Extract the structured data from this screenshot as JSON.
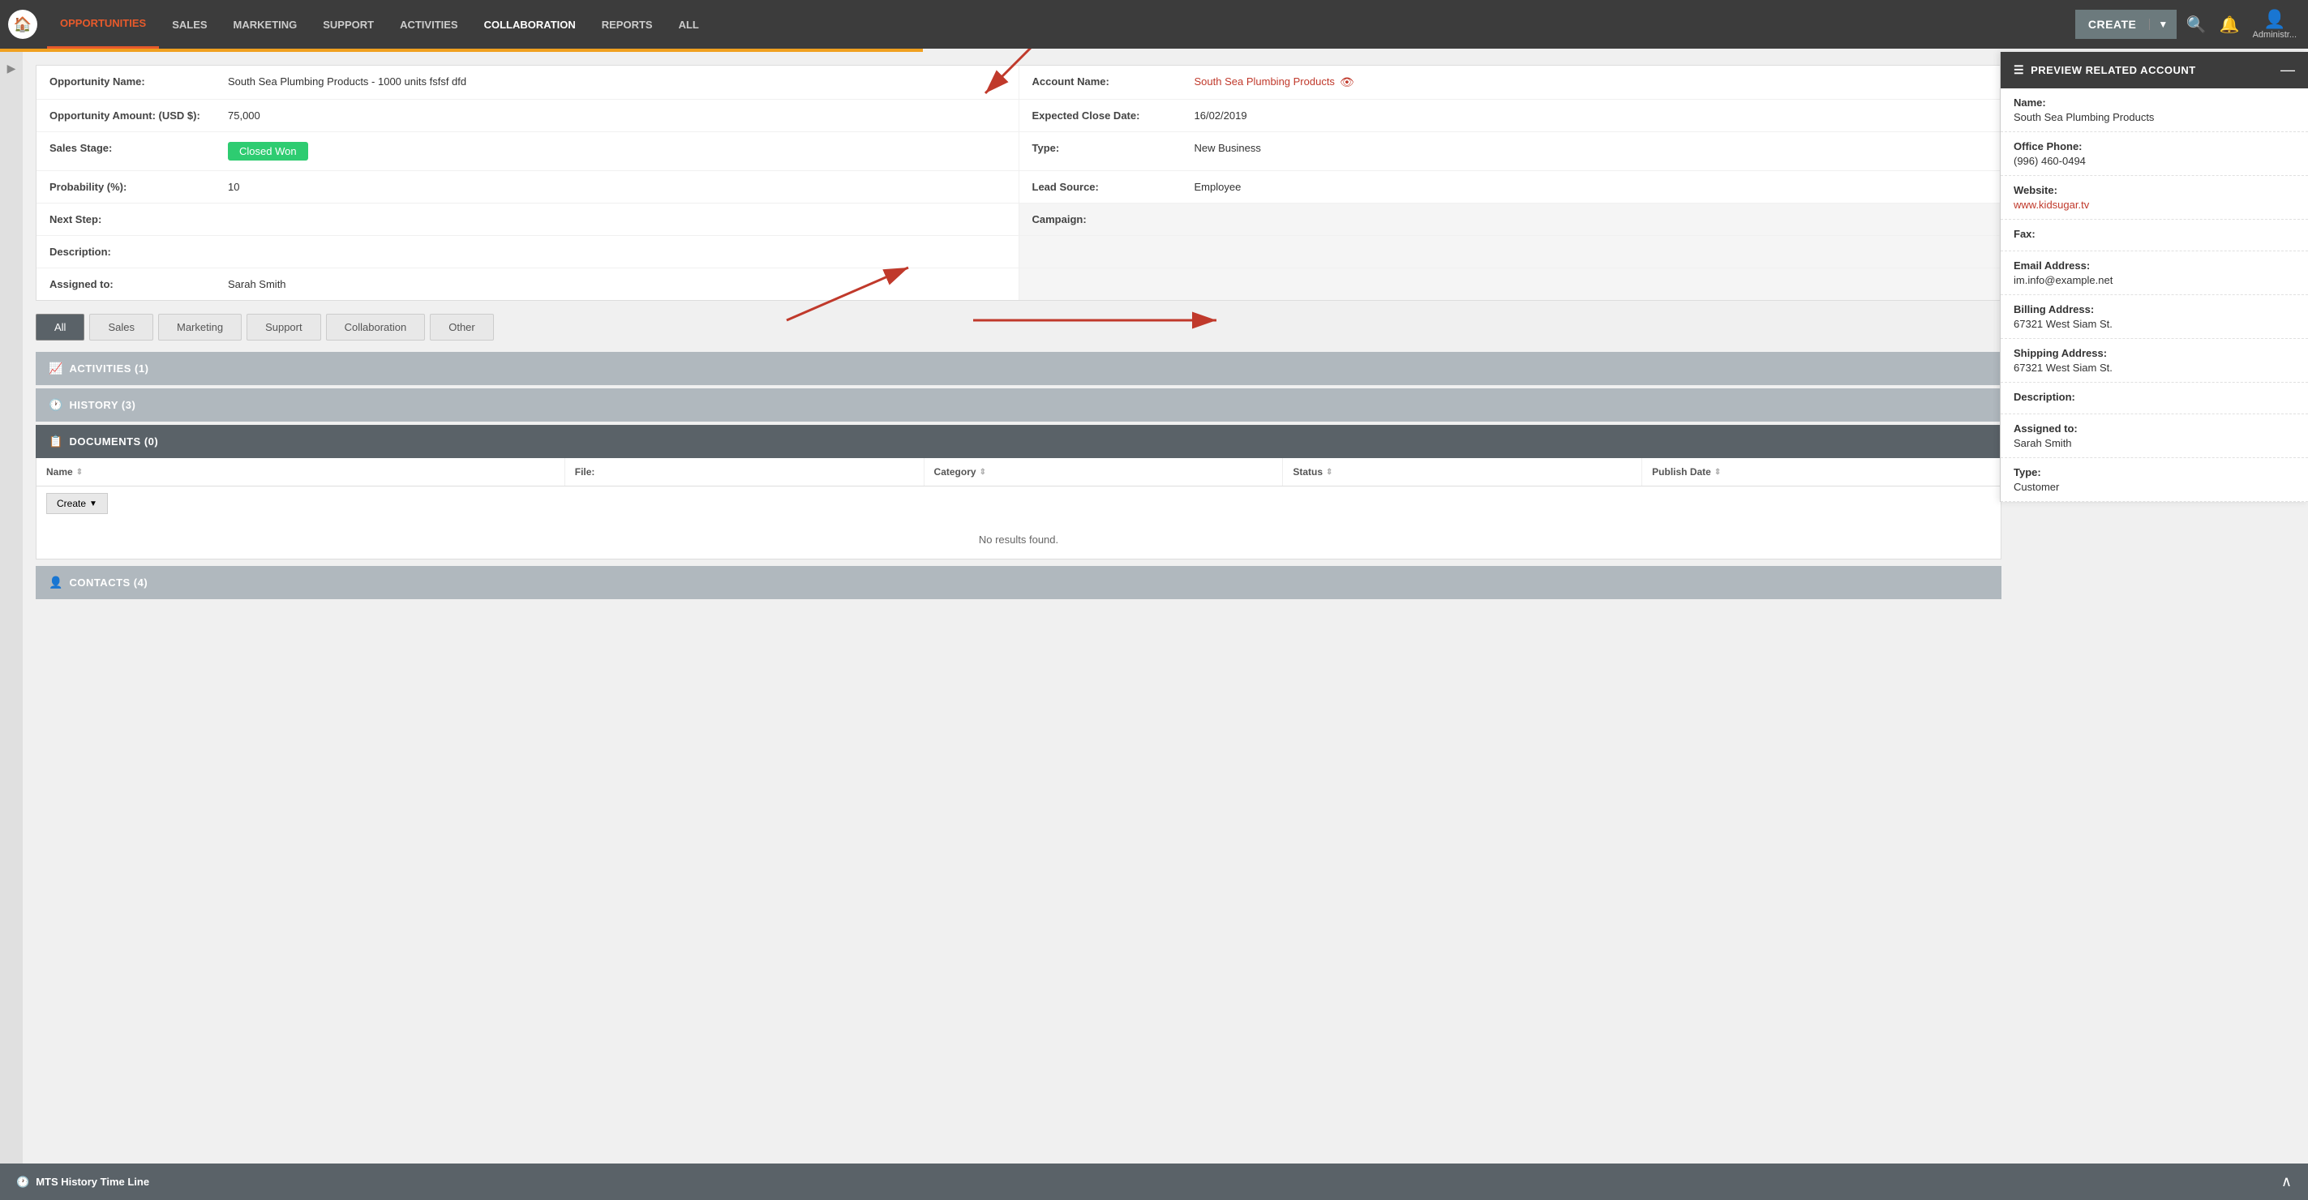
{
  "nav": {
    "logo_icon": "🏠",
    "items": [
      {
        "label": "OPPORTUNITIES",
        "active": true
      },
      {
        "label": "SALES",
        "active": false
      },
      {
        "label": "MARKETING",
        "active": false
      },
      {
        "label": "SUPPORT",
        "active": false
      },
      {
        "label": "ACTIVITIES",
        "active": false
      },
      {
        "label": "COLLABORATION",
        "active": false,
        "highlight": true
      },
      {
        "label": "REPORTS",
        "active": false
      },
      {
        "label": "ALL",
        "active": false
      }
    ],
    "create_label": "CREATE",
    "user_label": "Administr..."
  },
  "detail": {
    "opportunity_name_label": "Opportunity Name:",
    "opportunity_name_value": "South Sea Plumbing Products - 1000 units fsfsf dfd",
    "opportunity_amount_label": "Opportunity Amount: (USD $):",
    "opportunity_amount_value": "75,000",
    "sales_stage_label": "Sales Stage:",
    "sales_stage_value": "Closed Won",
    "probability_label": "Probability (%):",
    "probability_value": "10",
    "next_step_label": "Next Step:",
    "next_step_value": "",
    "description_label": "Description:",
    "description_value": "",
    "assigned_to_label": "Assigned to:",
    "assigned_to_value": "Sarah Smith",
    "account_name_label": "Account Name:",
    "account_name_value": "South Sea Plumbing Products",
    "expected_close_label": "Expected Close Date:",
    "expected_close_value": "16/02/2019",
    "type_label": "Type:",
    "type_value": "New Business",
    "lead_source_label": "Lead Source:",
    "lead_source_value": "Employee",
    "campaign_label": "Campaign:",
    "campaign_value": ""
  },
  "tabs": [
    {
      "label": "All",
      "active": true
    },
    {
      "label": "Sales",
      "active": false
    },
    {
      "label": "Marketing",
      "active": false
    },
    {
      "label": "Support",
      "active": false
    },
    {
      "label": "Collaboration",
      "active": false
    },
    {
      "label": "Other",
      "active": false
    }
  ],
  "sections": {
    "activities": {
      "title": "ACTIVITIES (1)",
      "icon": "📈"
    },
    "history": {
      "title": "HISTORY (3)",
      "icon": "🕐"
    },
    "documents": {
      "title": "DOCUMENTS (0)",
      "icon": "📋"
    },
    "contacts": {
      "title": "CONTACTS (4)",
      "icon": "👤"
    }
  },
  "documents_table": {
    "columns": [
      {
        "label": "Name",
        "sortable": true
      },
      {
        "label": "File:",
        "sortable": false
      },
      {
        "label": "Category",
        "sortable": true
      },
      {
        "label": "Status",
        "sortable": true
      },
      {
        "label": "Publish Date",
        "sortable": true
      }
    ],
    "create_label": "Create",
    "no_results": "No results found."
  },
  "preview": {
    "title": "PREVIEW RELATED ACCOUNT",
    "close": "—",
    "fields": [
      {
        "label": "Name:",
        "value": "South Sea Plumbing Products",
        "link": false
      },
      {
        "label": "Office Phone:",
        "value": "(996) 460-0494",
        "link": false
      },
      {
        "label": "Website:",
        "value": "www.kidsugar.tv",
        "link": true
      },
      {
        "label": "Fax:",
        "value": "",
        "link": false
      },
      {
        "label": "Email Address:",
        "value": "im.info@example.net",
        "link": false
      },
      {
        "label": "Billing Address:",
        "value": "67321 West Siam St.",
        "link": false
      },
      {
        "label": "Shipping Address:",
        "value": "67321 West Siam St.",
        "link": false
      },
      {
        "label": "Description:",
        "value": "",
        "link": false
      },
      {
        "label": "Assigned to:",
        "value": "Sarah Smith",
        "link": false
      },
      {
        "label": "Type:",
        "value": "Customer",
        "link": false
      }
    ]
  },
  "history_bar": {
    "icon": "🕐",
    "title": "MTS History Time Line"
  },
  "colors": {
    "nav_bg": "#3c3c3c",
    "active_tab_bg": "#5a6268",
    "section_dark_bg": "#5a6268",
    "section_light_bg": "#b0b8be",
    "badge_green": "#2ecc71",
    "link_red": "#c0392b",
    "preview_header_bg": "#3c3c3c"
  }
}
